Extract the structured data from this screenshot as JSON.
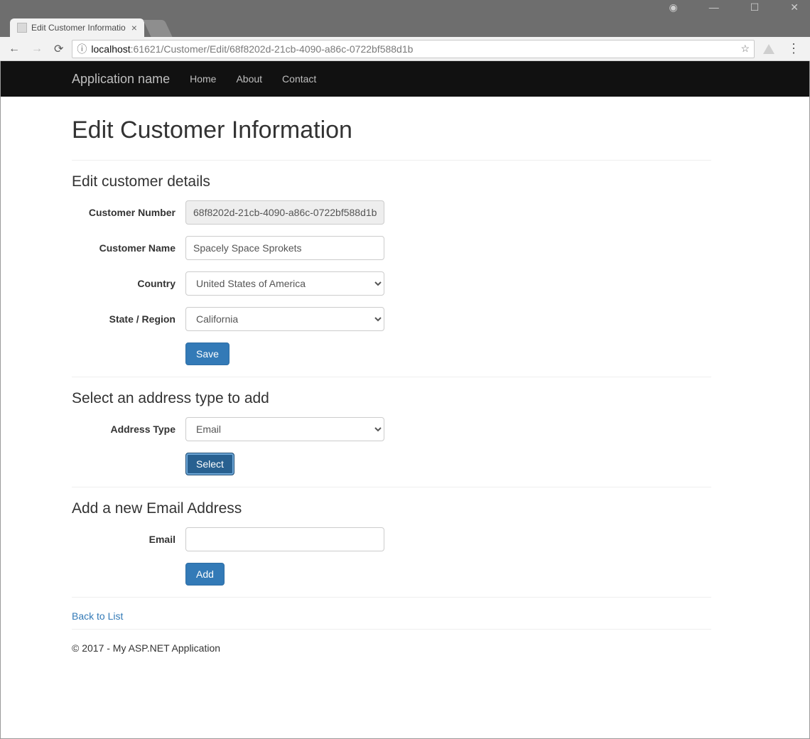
{
  "browser": {
    "tab_title": "Edit Customer Informatio",
    "url_host": "localhost",
    "url_port": ":61621",
    "url_path": "/Customer/Edit/68f8202d-21cb-4090-a86c-0722bf588d1b"
  },
  "navbar": {
    "brand": "Application name",
    "links": {
      "home": "Home",
      "about": "About",
      "contact": "Contact"
    }
  },
  "page": {
    "title": "Edit Customer Information"
  },
  "details": {
    "heading": "Edit customer details",
    "labels": {
      "customer_number": "Customer Number",
      "customer_name": "Customer Name",
      "country": "Country",
      "region": "State / Region"
    },
    "values": {
      "customer_number": "68f8202d-21cb-4090-a86c-0722bf588d1b",
      "customer_name": "Spacely Space Sprokets",
      "country": "United States of America",
      "region": "California"
    },
    "save_label": "Save"
  },
  "address_type": {
    "heading": "Select an address type to add",
    "label": "Address Type",
    "value": "Email",
    "select_label": "Select"
  },
  "email": {
    "heading": "Add a new Email Address",
    "label": "Email",
    "value": "",
    "add_label": "Add"
  },
  "footer": {
    "back_link": "Back to List",
    "copyright": "© 2017 - My ASP.NET Application"
  }
}
